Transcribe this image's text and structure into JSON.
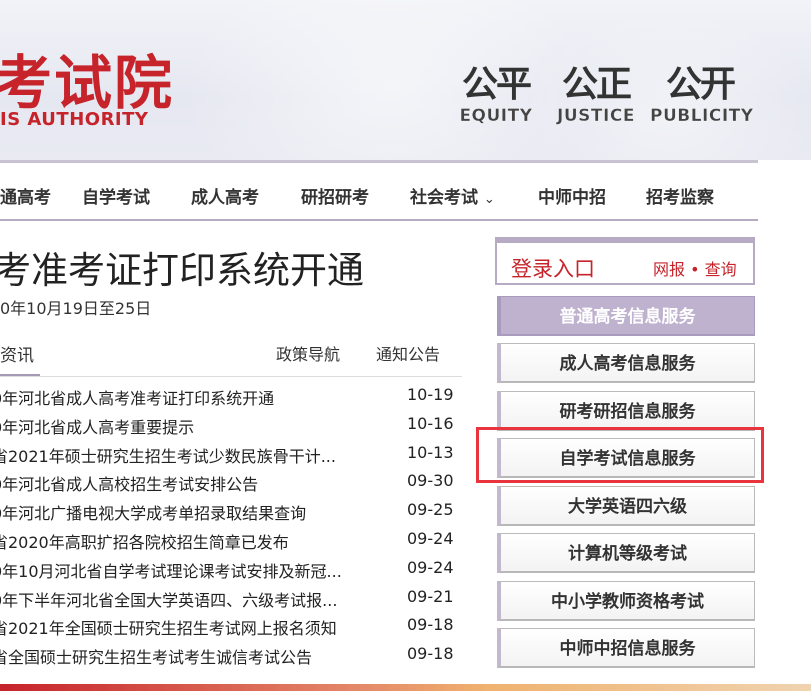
{
  "header": {
    "logo_cn": "考试院",
    "logo_en": "IS AUTHORITY",
    "mottos": [
      {
        "cn": "公平",
        "en": "EQUITY"
      },
      {
        "cn": "公正",
        "en": "JUSTICE"
      },
      {
        "cn": "公开",
        "en": "PUBLICITY"
      }
    ]
  },
  "nav": {
    "items": [
      "通高考",
      "自学考试",
      "成人高考",
      "研招研考",
      "社会考试",
      "中师中招",
      "招考监察"
    ],
    "dropdown_icon": "chevron-down-icon"
  },
  "article": {
    "headline": "考准考证打印系统开通",
    "dateline": "0年10月19日至25日"
  },
  "tabs": {
    "active": "资讯",
    "second": "政策导航",
    "third": "通知公告"
  },
  "news": [
    {
      "title": "0年河北省成人高考准考证打印系统开通",
      "date": "10-19"
    },
    {
      "title": "0年河北省成人高考重要提示",
      "date": "10-16"
    },
    {
      "title": "省2021年硕士研究生招生考试少数民族骨干计...",
      "date": "10-13"
    },
    {
      "title": "0年河北省成人高校招生考试安排公告",
      "date": "09-30"
    },
    {
      "title": "0年河北广播电视大学成考单招录取结果查询",
      "date": "09-25"
    },
    {
      "title": "省2020年高职扩招各院校招生简章已发布",
      "date": "09-24"
    },
    {
      "title": "0年10月河北省自学考试理论课考试安排及新冠...",
      "date": "09-24"
    },
    {
      "title": "0年下半年河北省全国大学英语四、六级考试报...",
      "date": "09-21"
    },
    {
      "title": "省2021年全国硕士研究生招生考试网上报名须知",
      "date": "09-18"
    },
    {
      "title": "省全国硕士研究生招生考试考生诚信考试公告",
      "date": "09-18"
    }
  ],
  "sidebar": {
    "login_title": "登录入口",
    "login_sub": "网报 • 查询",
    "services": [
      "普通高考信息服务",
      "成人高考信息服务",
      "研考研招信息服务",
      "自学考试信息服务",
      "大学英语四六级",
      "计算机等级考试",
      "中小学教师资格考试",
      "中师中招信息服务"
    ]
  },
  "colors": {
    "brand_red": "#c6232b",
    "accent_purple": "#bfb2cf",
    "highlight_red": "#e8343c"
  }
}
